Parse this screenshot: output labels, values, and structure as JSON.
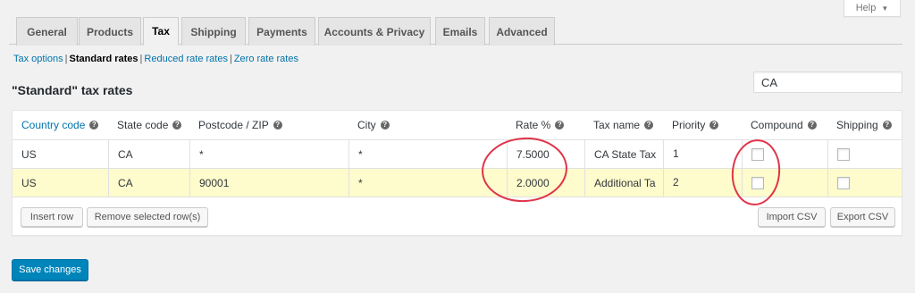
{
  "help": {
    "label": "Help"
  },
  "tabs": [
    {
      "label": "General"
    },
    {
      "label": "Products"
    },
    {
      "label": "Tax"
    },
    {
      "label": "Shipping"
    },
    {
      "label": "Payments"
    },
    {
      "label": "Accounts & Privacy"
    },
    {
      "label": "Emails"
    },
    {
      "label": "Advanced"
    }
  ],
  "active_tab": "Tax",
  "sections": {
    "tax_options": "Tax options",
    "standard_rates": "Standard rates",
    "reduced_rates": "Reduced rate rates",
    "zero_rates": "Zero rate rates"
  },
  "heading": "\"Standard\" tax rates",
  "search": {
    "value": "CA"
  },
  "table": {
    "columns": [
      {
        "label": "Country code"
      },
      {
        "label": "State code"
      },
      {
        "label": "Postcode / ZIP"
      },
      {
        "label": "City"
      },
      {
        "label": "Rate %"
      },
      {
        "label": "Tax name"
      },
      {
        "label": "Priority"
      },
      {
        "label": "Compound"
      },
      {
        "label": "Shipping"
      }
    ],
    "rows": [
      {
        "country": "US",
        "state": "CA",
        "postcode": "*",
        "city": "*",
        "rate": "7.5000",
        "name": "CA State Tax",
        "priority": "1",
        "compound": false,
        "shipping": false
      },
      {
        "country": "US",
        "state": "CA",
        "postcode": "90001",
        "city": "*",
        "rate": "2.0000",
        "name": "Additional Ta",
        "priority": "2",
        "compound": false,
        "shipping": false
      }
    ]
  },
  "buttons": {
    "insert_row": "Insert row",
    "remove_rows": "Remove selected row(s)",
    "import_csv": "Import CSV",
    "export_csv": "Export CSV",
    "save": "Save changes"
  },
  "help_tip_glyph": "?",
  "colors": {
    "link": "#0073aa",
    "highlight_row": "#fefbcc",
    "primary": "#0085ba",
    "annotation": "#e0354b"
  }
}
